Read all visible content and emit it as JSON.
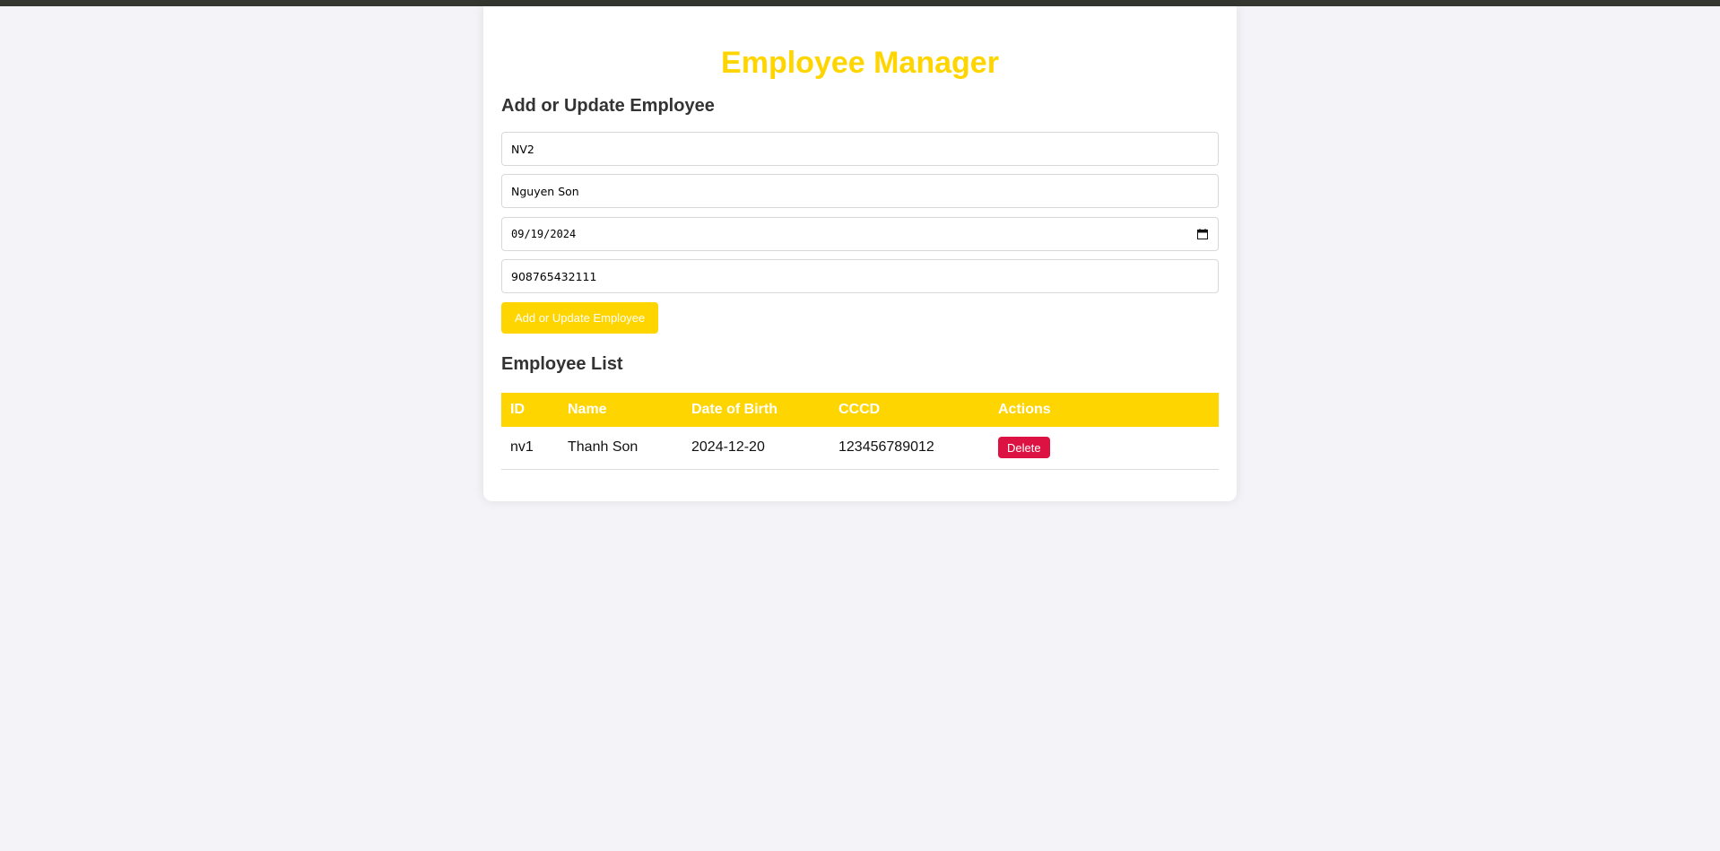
{
  "page": {
    "title": "Employee Manager"
  },
  "form": {
    "heading": "Add or Update Employee",
    "id_value": "NV2",
    "name_value": "Nguyen Son",
    "dob_value": "09/19/2024",
    "cccd_value": "908765432111",
    "submit_label": "Add or Update Employee"
  },
  "list": {
    "heading": "Employee List",
    "columns": [
      "ID",
      "Name",
      "Date of Birth",
      "CCCD",
      "Actions"
    ],
    "rows": [
      {
        "id": "nv1",
        "name": "Thanh Son",
        "dob": "2024-12-20",
        "cccd": "123456789012",
        "action_label": "Delete"
      }
    ]
  },
  "colors": {
    "accent": "#ffd500",
    "danger": "#dc1342",
    "background": "#f4f4f8",
    "topbar": "#33372f"
  },
  "icons": {
    "date_picker": "calendar-icon"
  }
}
